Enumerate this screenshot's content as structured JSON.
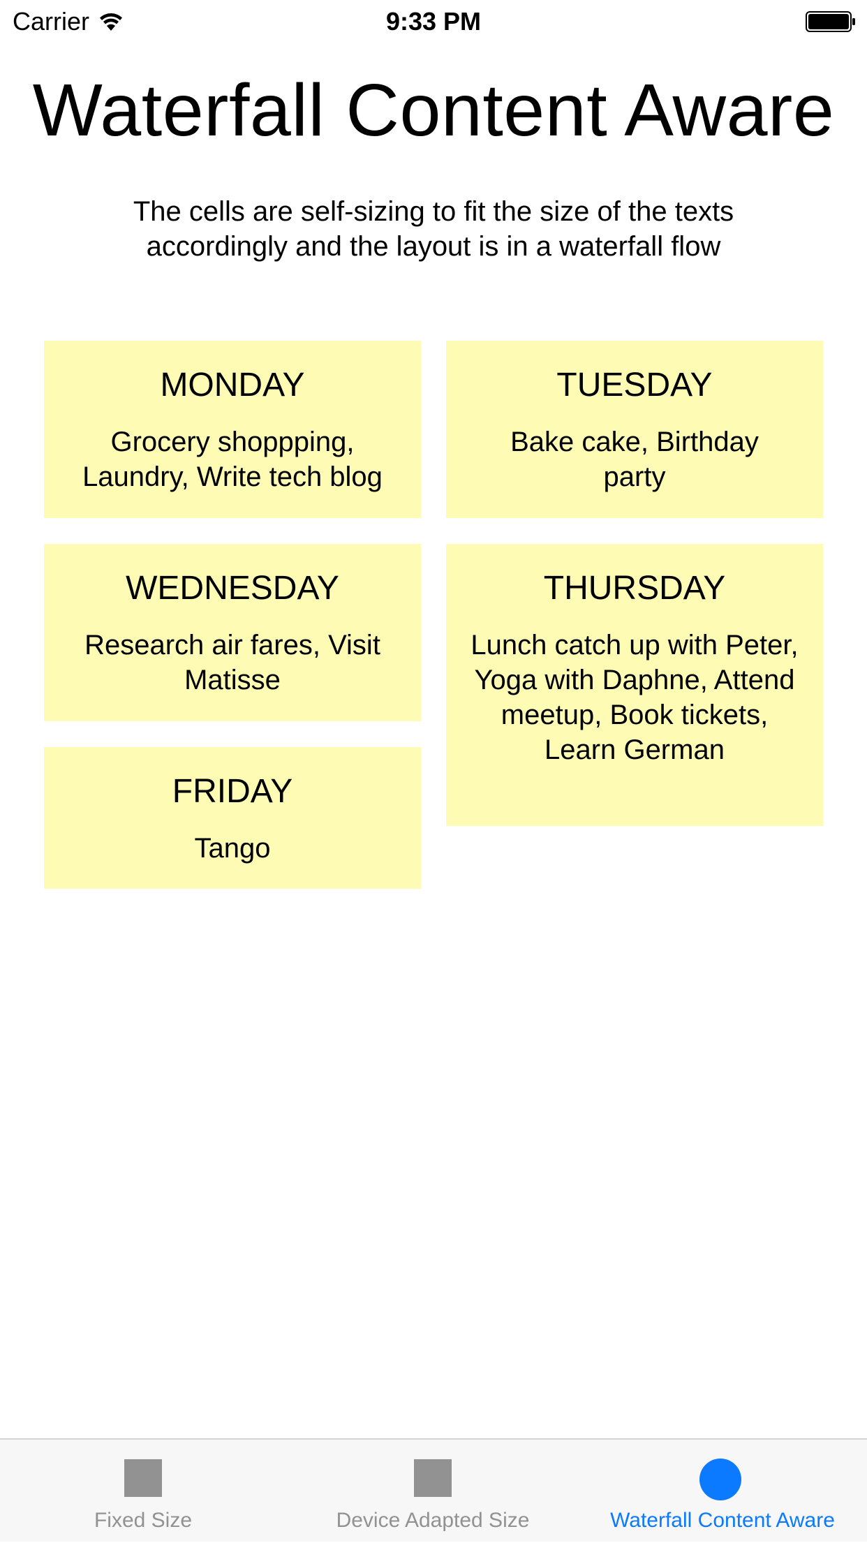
{
  "status_bar": {
    "carrier": "Carrier",
    "time": "9:33 PM",
    "icons": [
      "wifi-icon",
      "battery-icon"
    ]
  },
  "header": {
    "title": "Waterfall Content Aware",
    "subtitle": "The cells are self-sizing to fit the size of the texts accordingly and the layout is in a waterfall flow"
  },
  "cards": [
    {
      "day": "MONDAY",
      "tasks": "Grocery shoppping, Laundry, Write tech blog"
    },
    {
      "day": "TUESDAY",
      "tasks": "Bake cake, Birthday party"
    },
    {
      "day": "WEDNESDAY",
      "tasks": "Research air fares, Visit Matisse"
    },
    {
      "day": "THURSDAY",
      "tasks": "Lunch catch up with Peter, Yoga with Daphne, Attend meetup, Book tickets, Learn German"
    },
    {
      "day": "FRIDAY",
      "tasks": "Tango"
    }
  ],
  "tab_bar": {
    "tabs": [
      {
        "label": "Fixed Size",
        "icon": "square-icon",
        "selected": false
      },
      {
        "label": "Device Adapted Size",
        "icon": "square-icon",
        "selected": false
      },
      {
        "label": "Waterfall Content Aware",
        "icon": "circle-icon",
        "selected": true
      }
    ]
  },
  "colors": {
    "card_background": "#fefbb4",
    "accent": "#0b7aff",
    "tab_inactive": "#929292",
    "tab_bar_background": "#f7f7f7"
  }
}
